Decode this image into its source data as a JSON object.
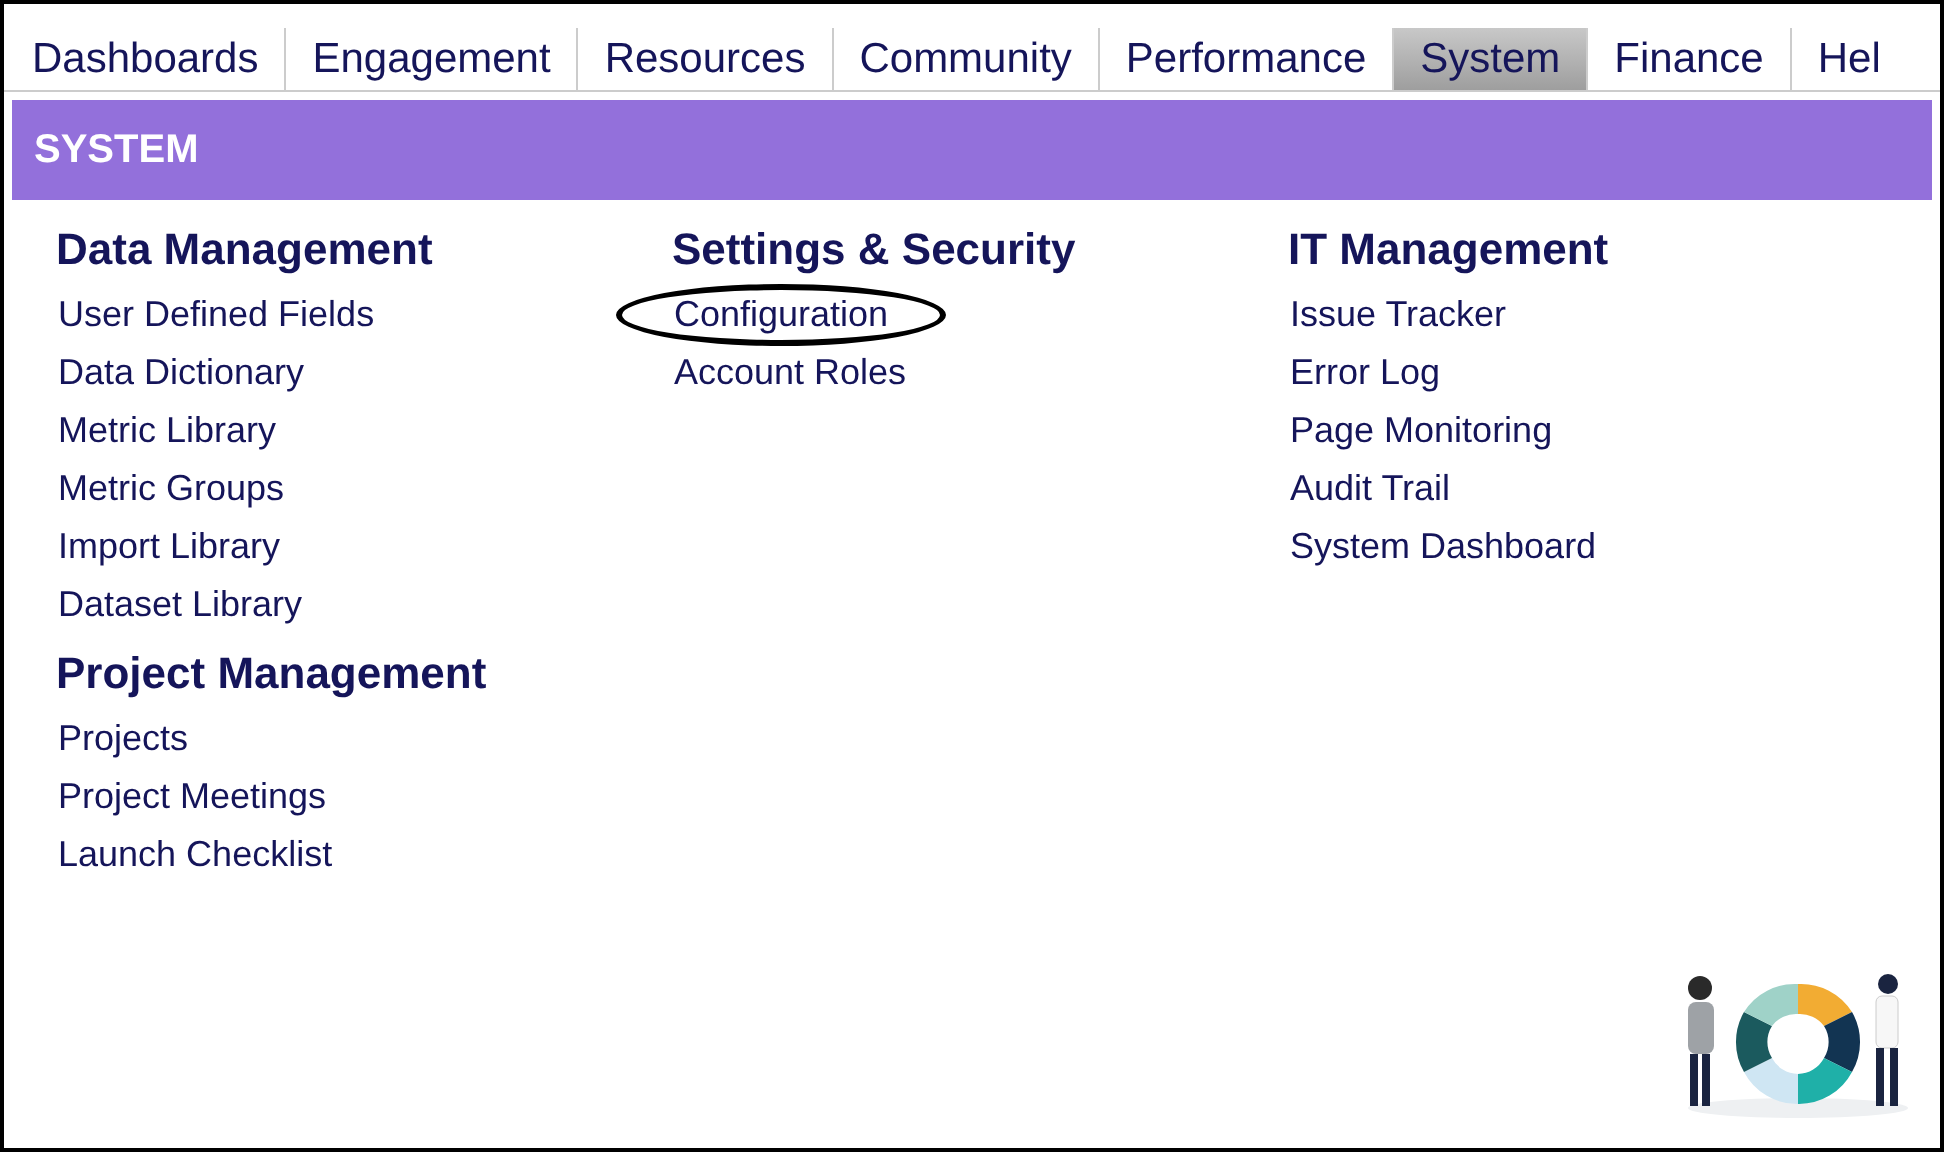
{
  "tabs": [
    {
      "label": "Dashboards",
      "selected": false
    },
    {
      "label": "Engagement",
      "selected": false
    },
    {
      "label": "Resources",
      "selected": false
    },
    {
      "label": "Community",
      "selected": false
    },
    {
      "label": "Performance",
      "selected": false
    },
    {
      "label": "System",
      "selected": true
    },
    {
      "label": "Finance",
      "selected": false
    },
    {
      "label": "Hel",
      "selected": false
    }
  ],
  "header": {
    "title": "SYSTEM"
  },
  "columns": [
    {
      "sections": [
        {
          "heading": "Data Management",
          "links": [
            {
              "label": "User Defined Fields",
              "circled": false
            },
            {
              "label": "Data Dictionary",
              "circled": false
            },
            {
              "label": "Metric Library",
              "circled": false
            },
            {
              "label": "Metric Groups",
              "circled": false
            },
            {
              "label": "Import Library",
              "circled": false
            },
            {
              "label": "Dataset Library",
              "circled": false
            }
          ]
        },
        {
          "heading": "Project Management",
          "links": [
            {
              "label": "Projects",
              "circled": false
            },
            {
              "label": "Project Meetings",
              "circled": false
            },
            {
              "label": "Launch Checklist",
              "circled": false
            }
          ]
        }
      ]
    },
    {
      "sections": [
        {
          "heading": "Settings & Security",
          "links": [
            {
              "label": "Configuration",
              "circled": true
            },
            {
              "label": "Account Roles",
              "circled": false
            }
          ]
        }
      ]
    },
    {
      "sections": [
        {
          "heading": "IT Management",
          "links": [
            {
              "label": "Issue Tracker",
              "circled": false
            },
            {
              "label": "Error Log",
              "circled": false
            },
            {
              "label": "Page Monitoring",
              "circled": false
            },
            {
              "label": "Audit Trail",
              "circled": false
            },
            {
              "label": "System Dashboard",
              "circled": false
            }
          ]
        }
      ]
    }
  ]
}
